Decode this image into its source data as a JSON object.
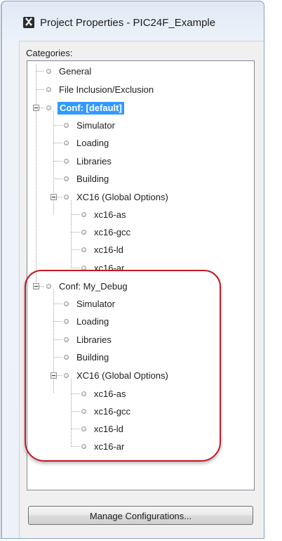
{
  "window": {
    "title": "Project Properties - PIC24F_Example",
    "app_icon": "puzzle-x-icon"
  },
  "categories_label": "Categories:",
  "tree": {
    "general": "General",
    "file_inclusion": "File Inclusion/Exclusion",
    "conf_default": {
      "label": "Conf: [default]",
      "simulator": "Simulator",
      "loading": "Loading",
      "libraries": "Libraries",
      "building": "Building",
      "xc16": {
        "label": "XC16 (Global Options)",
        "as": "xc16-as",
        "gcc": "xc16-gcc",
        "ld": "xc16-ld",
        "ar": "xc16-ar"
      }
    },
    "conf_debug": {
      "label": "Conf: My_Debug",
      "simulator": "Simulator",
      "loading": "Loading",
      "libraries": "Libraries",
      "building": "Building",
      "xc16": {
        "label": "XC16 (Global Options)",
        "as": "xc16-as",
        "gcc": "xc16-gcc",
        "ld": "xc16-ld",
        "ar": "xc16-ar"
      }
    }
  },
  "buttons": {
    "manage": "Manage Configurations..."
  },
  "colors": {
    "selection": "#3399ff",
    "highlight_oval": "#c01a28"
  }
}
